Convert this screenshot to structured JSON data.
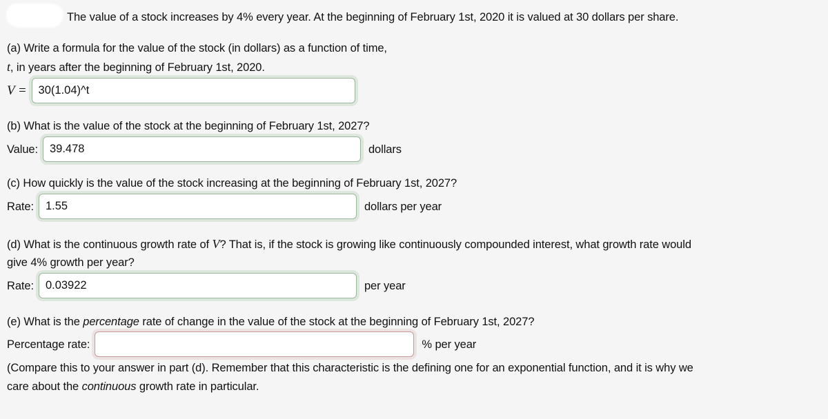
{
  "problem": {
    "statement": "The value of a stock increases by 4% every year. At the beginning of February 1st, 2020 it is valued at 30 dollars per share.",
    "redaction_label": "redacted-name-block"
  },
  "parts": {
    "a": {
      "prompt_line1": "(a) Write a formula for the value of the stock (in dollars) as a function of time,",
      "prompt_line2_var": "t",
      "prompt_line2_rest": ", in years after the beginning of February 1st, 2020.",
      "label": "V =",
      "value": "30(1.04)^t",
      "placeholder": "",
      "status": "correct",
      "suffix": ""
    },
    "b": {
      "prompt": "(b) What is the value of the stock at the beginning of February 1st, 2027?",
      "label": "Value:",
      "value": "39.478",
      "placeholder": "",
      "status": "correct",
      "suffix": "dollars"
    },
    "c": {
      "prompt": "(c) How quickly is the value of the stock increasing at the beginning of February 1st, 2027?",
      "label": "Rate:",
      "value": "1.55",
      "placeholder": "",
      "status": "correct",
      "suffix": "dollars per year"
    },
    "d": {
      "prompt_pre": "(d) What is the continuous growth rate of ",
      "prompt_var": "V",
      "prompt_post": "? That is, if the stock is growing like continuously compounded interest, what growth rate would",
      "prompt_line2": "give 4% growth per year?",
      "label": "Rate:",
      "value": "0.03922",
      "placeholder": "",
      "status": "correct",
      "suffix": "per year"
    },
    "e": {
      "prompt_pre": "(e) What is the ",
      "prompt_em": "percentage",
      "prompt_post": " rate of change in the value of the stock at the beginning of February 1st, 2027?",
      "label": "Percentage rate:",
      "value": "",
      "placeholder": "",
      "status": "incorrect",
      "suffix": "% per year",
      "note_line1_pre": "(Compare this to your answer in part (d). Remember that this characteristic is the defining one for an exponential function, and it is why we",
      "note_line2_pre": "care about the ",
      "note_line2_em": "continuous",
      "note_line2_post": " growth rate in particular."
    }
  },
  "colors": {
    "page_background": "#f5f5f5",
    "text": "#111111",
    "correct_border": "#9cb89c",
    "incorrect_border": "#c79a9a",
    "field_background": "#ffffff"
  }
}
